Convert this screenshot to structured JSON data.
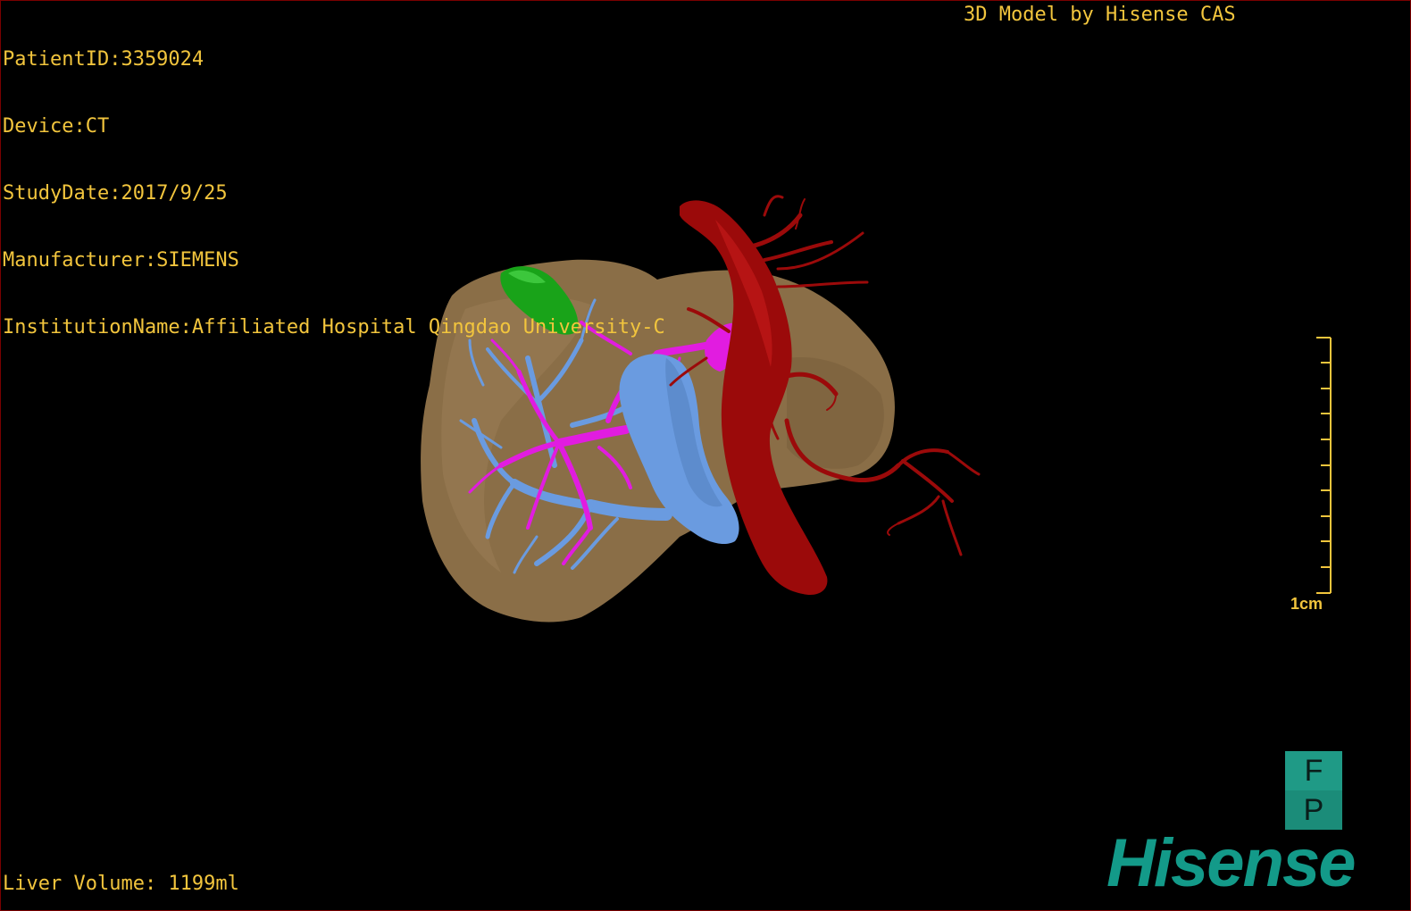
{
  "colors": {
    "overlay_text": "#f2c53d",
    "liver": "#8a6e47",
    "artery": "#9b0a0a",
    "portal_vein": "#6a9be0",
    "hepatic_vein": "#e11ce0",
    "gallbladder": "#19a319",
    "brand": "#139a89",
    "cube_face": "#1f9a86",
    "scale": "#f2c53d"
  },
  "study_info": {
    "patient_id": "PatientID:3359024",
    "device": "Device:CT",
    "study_date": "StudyDate:2017/9/25",
    "manufacturer": "Manufacturer:SIEMENS",
    "institution": "InstitutionName:Affiliated Hospital Qingdao University-C"
  },
  "watermark": "3D Model by Hisense CAS",
  "liver_volume": "Liver Volume: 1199ml",
  "scale_bar": {
    "label": "1cm"
  },
  "orientation_cube": {
    "top_face": "F",
    "bottom_face": "P"
  },
  "brand": "Hisense"
}
